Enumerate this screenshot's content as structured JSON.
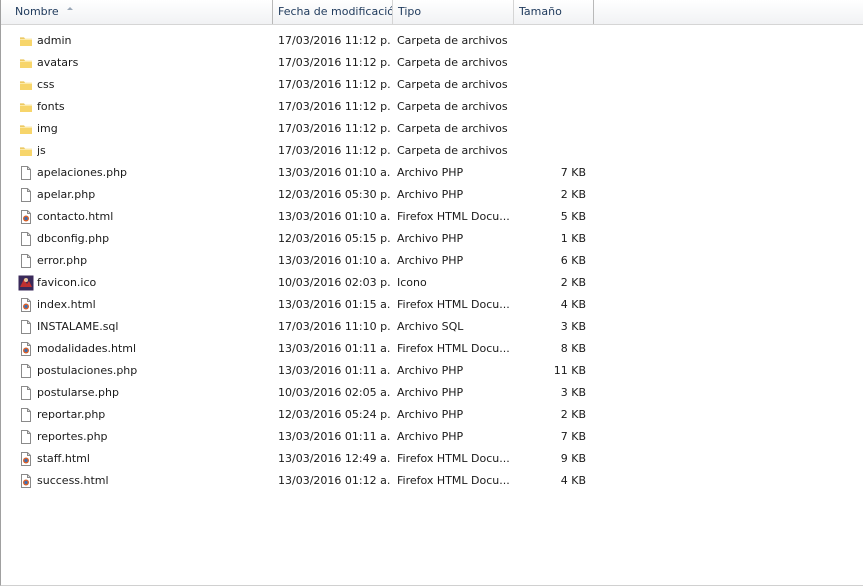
{
  "columns": {
    "name": "Nombre",
    "date": "Fecha de modificación",
    "type": "Tipo",
    "size": "Tamaño"
  },
  "colors": {
    "folder": "#f2c94c",
    "header_text": "#1e395b",
    "header_bg": "#f1f2f4"
  },
  "files": [
    {
      "name": "admin",
      "date": "17/03/2016 11:12 p...",
      "type": "Carpeta de archivos",
      "size": "",
      "icon": "folder-icon"
    },
    {
      "name": "avatars",
      "date": "17/03/2016 11:12 p...",
      "type": "Carpeta de archivos",
      "size": "",
      "icon": "folder-icon"
    },
    {
      "name": "css",
      "date": "17/03/2016 11:12 p...",
      "type": "Carpeta de archivos",
      "size": "",
      "icon": "folder-icon"
    },
    {
      "name": "fonts",
      "date": "17/03/2016 11:12 p...",
      "type": "Carpeta de archivos",
      "size": "",
      "icon": "folder-icon"
    },
    {
      "name": "img",
      "date": "17/03/2016 11:12 p...",
      "type": "Carpeta de archivos",
      "size": "",
      "icon": "folder-icon"
    },
    {
      "name": "js",
      "date": "17/03/2016 11:12 p...",
      "type": "Carpeta de archivos",
      "size": "",
      "icon": "folder-icon"
    },
    {
      "name": "apelaciones.php",
      "date": "13/03/2016 01:10 a...",
      "type": "Archivo PHP",
      "size": "7 KB",
      "icon": "file-icon"
    },
    {
      "name": "apelar.php",
      "date": "12/03/2016 05:30 p...",
      "type": "Archivo PHP",
      "size": "2 KB",
      "icon": "file-icon"
    },
    {
      "name": "contacto.html",
      "date": "13/03/2016 01:10 a...",
      "type": "Firefox HTML Docu...",
      "size": "5 KB",
      "icon": "html-file-icon"
    },
    {
      "name": "dbconfig.php",
      "date": "12/03/2016 05:15 p...",
      "type": "Archivo PHP",
      "size": "1 KB",
      "icon": "file-icon"
    },
    {
      "name": "error.php",
      "date": "13/03/2016 01:10 a...",
      "type": "Archivo PHP",
      "size": "6 KB",
      "icon": "file-icon"
    },
    {
      "name": "favicon.ico",
      "date": "10/03/2016 02:03 p...",
      "type": "Icono",
      "size": "2 KB",
      "icon": "favicon-icon"
    },
    {
      "name": "index.html",
      "date": "13/03/2016 01:15 a...",
      "type": "Firefox HTML Docu...",
      "size": "4 KB",
      "icon": "html-file-icon"
    },
    {
      "name": "INSTALAME.sql",
      "date": "17/03/2016 11:10 p...",
      "type": "Archivo SQL",
      "size": "3 KB",
      "icon": "file-icon"
    },
    {
      "name": "modalidades.html",
      "date": "13/03/2016 01:11 a...",
      "type": "Firefox HTML Docu...",
      "size": "8 KB",
      "icon": "html-file-icon"
    },
    {
      "name": "postulaciones.php",
      "date": "13/03/2016 01:11 a...",
      "type": "Archivo PHP",
      "size": "11 KB",
      "icon": "file-icon"
    },
    {
      "name": "postularse.php",
      "date": "10/03/2016 02:05 a...",
      "type": "Archivo PHP",
      "size": "3 KB",
      "icon": "file-icon"
    },
    {
      "name": "reportar.php",
      "date": "12/03/2016 05:24 p...",
      "type": "Archivo PHP",
      "size": "2 KB",
      "icon": "file-icon"
    },
    {
      "name": "reportes.php",
      "date": "13/03/2016 01:11 a...",
      "type": "Archivo PHP",
      "size": "7 KB",
      "icon": "file-icon"
    },
    {
      "name": "staff.html",
      "date": "13/03/2016 12:49 a...",
      "type": "Firefox HTML Docu...",
      "size": "9 KB",
      "icon": "html-file-icon"
    },
    {
      "name": "success.html",
      "date": "13/03/2016 01:12 a...",
      "type": "Firefox HTML Docu...",
      "size": "4 KB",
      "icon": "html-file-icon"
    }
  ]
}
